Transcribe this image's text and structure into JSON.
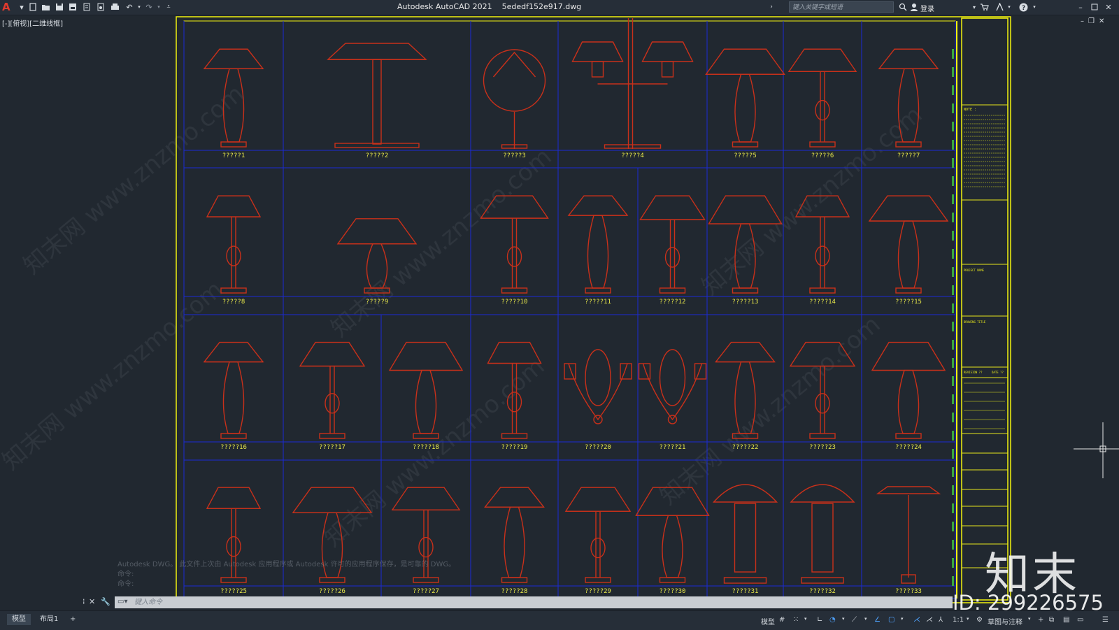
{
  "titlebar": {
    "app_logo": "A",
    "title": "Autodesk AutoCAD 2021    5ededf152e917.dwg",
    "search_placeholder": "键入关键字或短语",
    "login_label": "登录",
    "icons": [
      "new-icon",
      "open-icon",
      "save-icon",
      "saveas-icon",
      "print-icon",
      "plot-icon",
      "undo-icon",
      "redo-icon",
      "search-icon",
      "user-icon",
      "cart-icon",
      "help-icon",
      "minimize-icon",
      "maximize-icon",
      "close-icon"
    ]
  },
  "viewport": {
    "label": "[-][俯视][二维线框]"
  },
  "drawing": {
    "colors": {
      "frame": "#f2f20f",
      "grid": "#1a2ad6",
      "lamps": "#c8301a",
      "labels": "#e9e94a",
      "titleblock": "#e6e61c"
    },
    "rows": [
      {
        "labels": [
          "?????1",
          "?????2",
          "?????3",
          "?????4",
          "?????5",
          "?????6",
          "?????7"
        ]
      },
      {
        "labels": [
          "?????8",
          "?????9",
          "?????10",
          "?????11",
          "?????12",
          "?????13",
          "?????14",
          "?????15"
        ]
      },
      {
        "labels": [
          "?????16",
          "?????17",
          "?????18",
          "?????19",
          "?????20",
          "?????21",
          "?????22",
          "?????23",
          "?????24"
        ]
      },
      {
        "labels": [
          "?????25",
          "?????26",
          "?????27",
          "?????28",
          "?????29",
          "?????30",
          "?????31",
          "?????32",
          "?????33"
        ]
      }
    ],
    "titleblock": {
      "notes_heading": "NOTE :",
      "project_label": "PROJECT NAME",
      "drawing_title_label": "DRAWING TITLE",
      "revision_label": "REVISION ??",
      "date_label": "DATE ??"
    }
  },
  "commandline": {
    "placeholder": "键入命令",
    "history": [
      "Autodesk DWG。 此文件上次由 Autodesk 应用程序或 Autodesk 许可的应用程序保存，是可靠的 DWG。",
      "命令:",
      "命令:"
    ]
  },
  "statusbar": {
    "tabs": [
      "模型",
      "布局1",
      "+"
    ],
    "model_label": "模型",
    "scale": "1:1",
    "workspace": "草图与注释"
  },
  "watermark": {
    "brand": "知末",
    "id": "ID: 299226575",
    "repeat_text": "知末网 www.znzmo.com"
  }
}
